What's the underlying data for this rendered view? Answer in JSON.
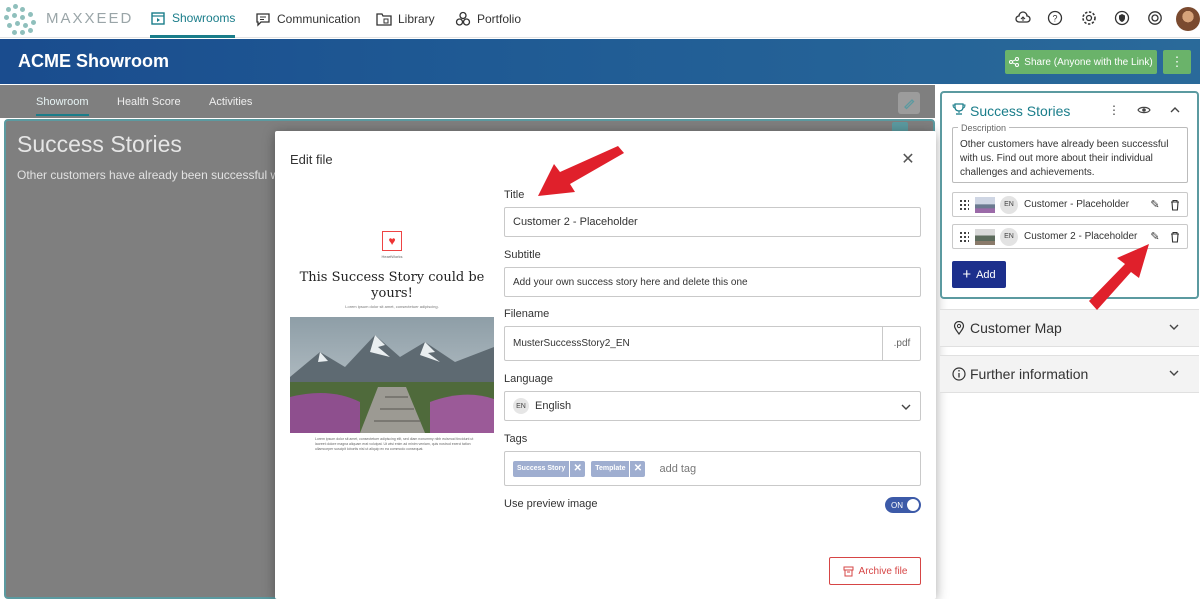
{
  "nav": {
    "logo_text": "MAXXEED",
    "items": [
      {
        "label": "Showrooms",
        "icon": "showroom-icon"
      },
      {
        "label": "Communication",
        "icon": "chat-icon"
      },
      {
        "label": "Library",
        "icon": "library-icon"
      },
      {
        "label": "Portfolio",
        "icon": "portfolio-icon"
      }
    ],
    "utility_icons": [
      "cloud-upload-icon",
      "help-icon",
      "settings-icon",
      "shield-icon",
      "settings-gear-icon"
    ]
  },
  "header": {
    "title": "ACME Showroom",
    "share_label": "Share (Anyone with the Link)",
    "more_label": "⋮"
  },
  "page": {
    "tabs": [
      "Showroom",
      "Health Score",
      "Activities"
    ],
    "section_title": "Success Stories",
    "section_desc": "Other customers have already been successful with us"
  },
  "modal": {
    "title": "Edit file",
    "preview": {
      "brand": "HeartWorks",
      "headline": "This Success Story could be yours!",
      "sub": "Lorem ipsum dolor sit amet, consectetuer adipiscing.",
      "body": "Lorem ipsum dolor sit amet, consectetuer adipiscing elit, sed diam nonummy nibh euismod tincidunt ut laoreet dolore magna aliquam erat volutpat. Ut wisi enim ad minim veniam, quis nostrud exerci tation ullamcorper suscipit lobortis nisl ut aliquip ex ea commodo consequat."
    },
    "fields": {
      "title_label": "Title",
      "title_value": "Customer 2 - Placeholder",
      "subtitle_label": "Subtitle",
      "subtitle_value": "Add your own success story here and delete this one",
      "filename_label": "Filename",
      "filename_value": "MusterSuccessStory2_EN",
      "filename_ext": ".pdf",
      "language_label": "Language",
      "language_code": "EN",
      "language_value": "English",
      "tags_label": "Tags",
      "tags": [
        "Success Story",
        "Template"
      ],
      "tag_placeholder": "add tag",
      "preview_label": "Use preview image",
      "preview_toggle": "ON"
    },
    "archive_label": "Archive file"
  },
  "right_panel": {
    "title": "Success Stories",
    "desc_legend": "Description",
    "desc_text": "Other customers have already been successful with us. Find out more about their individual challenges and achievements.",
    "files": [
      {
        "lang": "EN",
        "name": "Customer - Placeholder"
      },
      {
        "lang": "EN",
        "name": "Customer 2 - Placeholder"
      }
    ],
    "add_label": "Add",
    "accordions": [
      "Customer Map",
      "Further information"
    ]
  },
  "colors": {
    "accent": "#1a7d8a",
    "header_blue": "#1a4c8e",
    "share_green": "#6ab36a",
    "add_blue": "#1c2f8c",
    "tag_bg": "#9faed0",
    "danger": "#d64545",
    "arrow": "#e0202b"
  }
}
